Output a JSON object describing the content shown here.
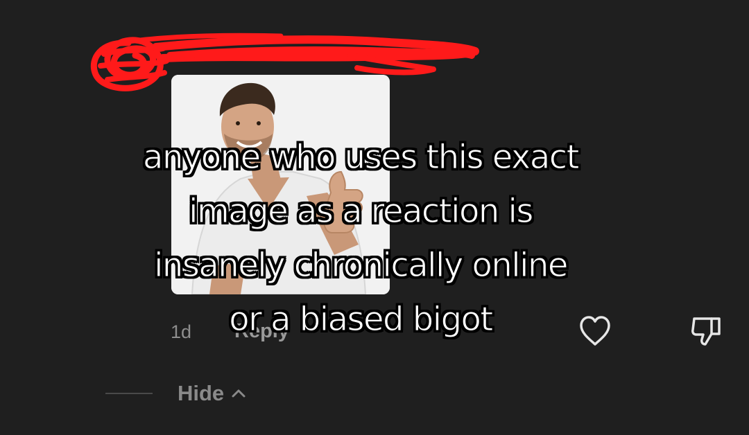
{
  "comment": {
    "timestamp": "1d",
    "reply_label": "Reply",
    "image_description": "stock photo of smiling man in white t-shirt giving thumbs up"
  },
  "actions": {
    "like_icon": "heart-outline-icon",
    "dislike_icon": "thumbs-down-outline-icon"
  },
  "replies": {
    "hide_label": "Hide",
    "hide_icon": "chevron-up-icon"
  },
  "caption": {
    "lines": [
      "anyone who uses this exact",
      "image as a reaction is",
      "insanely chronically online",
      "or a biased bigot"
    ]
  },
  "colors": {
    "background": "#1f1f1f",
    "censor_scribble": "#ff1a1a",
    "muted_text": "#8e8e8e",
    "icon": "#e6e6e6"
  }
}
